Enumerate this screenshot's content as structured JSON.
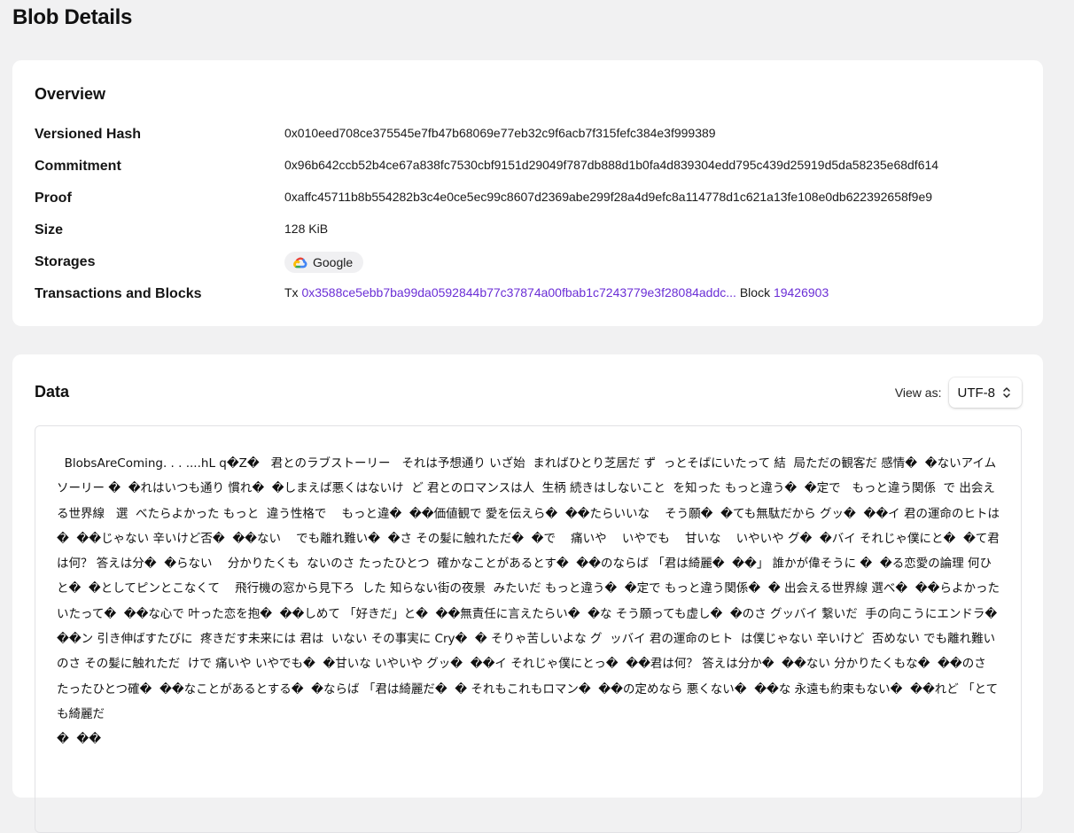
{
  "page": {
    "title": "Blob Details"
  },
  "overview": {
    "title": "Overview",
    "rows": {
      "versioned_hash": {
        "label": "Versioned Hash",
        "value": "0x010eed708ce375545e7fb47b68069e77eb32c9f6acb7f315fefc384e3f999389"
      },
      "commitment": {
        "label": "Commitment",
        "value": "0x96b642ccb52b4ce67a838fc7530cbf9151d29049f787db888d1b0fa4d839304edd795c439d25919d5da58235e68df614"
      },
      "proof": {
        "label": "Proof",
        "value": "0xaffc45711b8b554282b3c4e0ce5ec99c8607d2369abe299f28a4d9efc8a114778d1c621a13fe108e0db622392658f9e9"
      },
      "size": {
        "label": "Size",
        "value": "128 KiB"
      },
      "storages": {
        "label": "Storages",
        "items": [
          {
            "name": "Google",
            "icon": "google-cloud-icon"
          }
        ]
      },
      "transactions": {
        "label": "Transactions and Blocks",
        "tx_prefix": "Tx",
        "tx_hash": "0x3588ce5ebb7ba99da0592844b77c37874a00fbab1c7243779e3f28084addc...",
        "block_prefix": "Block",
        "block_number": "19426903"
      }
    }
  },
  "data_section": {
    "title": "Data",
    "view_as_label": "View as:",
    "encoding_selected": "UTF-8",
    "content": "  BlobsAreComing. . . ....hL q�Z�   君とのラブストーリー   それは予想通り いざ始  まればひとり芝居だ ず  っとそばにいたって 結  局ただの観客だ 感情�  �ないアイムソーリー �  �れはいつも通り 慣れ�  �しまえば悪くはないけ  ど 君とのロマンスは人  生柄 続きはしないこと  を知った もっと違う�  �定で   もっと違う関係  で 出会える世界線   選  べたらよかった もっと  違う性格で    もっと違�  ��価値観で 愛を伝えら�  ��たらいいな    そう願�  �ても無駄だから グッ�  ��イ 君の運命のヒトは�  ��じゃない 辛いけど否�  ��ない    でも離れ難い�  �さ その髪に触れただ�  �で    痛いや    いやでも    甘いな    いやいや グ�  �バイ それじゃ僕にと�  �て君は何？ 答えは分�  �らない    分かりたくも  ないのさ たったひとつ  確かなことがあるとす�  ��のならば 「君は綺麗�  ��」 誰かが偉そうに �  �る恋愛の論理 何ひと�  �としてピンとこなくて    飛行機の窓から見下ろ  した 知らない街の夜景  みたいだ もっと違う�  �定で もっと違う関係�  � 出会える世界線 選べ�  ��らよかった いたって�  ��な心で 叶った恋を抱�  ��しめて 「好きだ」と�  ��無責任に言えたらい�  �な そう願っても虚し�  �のさ グッバイ 繋いだ  手の向こうにエンドラ�  ��ン 引き伸ばすたびに  疼きだす未来には 君は  いない その事実に Cry�  � そりゃ苦しいよな グ  ッバイ 君の運命のヒト  は僕じゃない 辛いけど  否めない でも離れ難い  のさ その髪に触れただ  けで 痛いや いやでも�  �甘いな いやいや グッ�  ��イ それじゃ僕にとっ�  ��君は何？ 答えは分か�  ��ない 分かりたくもな�  ��のさ たったひとつ確�  ��なことがあるとする�  �ならば 「君は綺麗だ�  � それもこれもロマン�  ��の定めなら 悪くない�  ��な 永遠も約束もない�  ��れど 「とても綺麗だ\n�  ��"
  },
  "colors": {
    "page_background": "#f1f1f2",
    "card_background": "#ffffff",
    "link": "#6b2fd6",
    "pill_background": "#f0f0f2"
  }
}
